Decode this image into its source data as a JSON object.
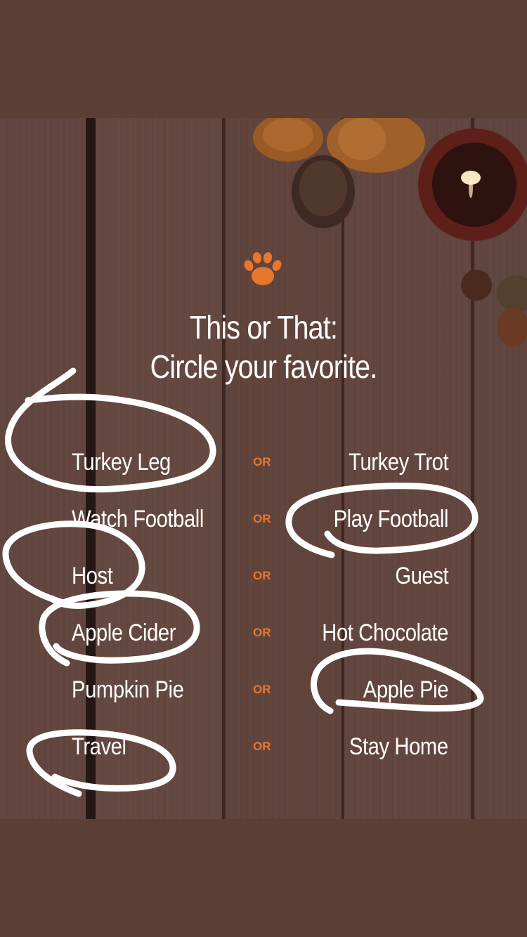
{
  "title": {
    "line1": "This or That:",
    "line2": "Circle your favorite."
  },
  "or_label": "OR",
  "rows": [
    {
      "left": "Turkey Leg",
      "right": "Turkey Trot",
      "circled": "left"
    },
    {
      "left": "Watch Football",
      "right": "Play Football",
      "circled": "right"
    },
    {
      "left": "Host",
      "right": "Guest",
      "circled": "left"
    },
    {
      "left": "Apple Cider",
      "right": "Hot Chocolate",
      "circled": "left"
    },
    {
      "left": "Pumpkin Pie",
      "right": "Apple Pie",
      "circled": "right"
    },
    {
      "left": "Travel",
      "right": "Stay Home",
      "circled": "left"
    }
  ],
  "colors": {
    "accent_orange": "#e8772e",
    "text": "#ffffff",
    "story_background": "#5b3f35",
    "circle_stroke": "#ffffff"
  },
  "icons": {
    "logo": "tiger-paw-icon"
  }
}
